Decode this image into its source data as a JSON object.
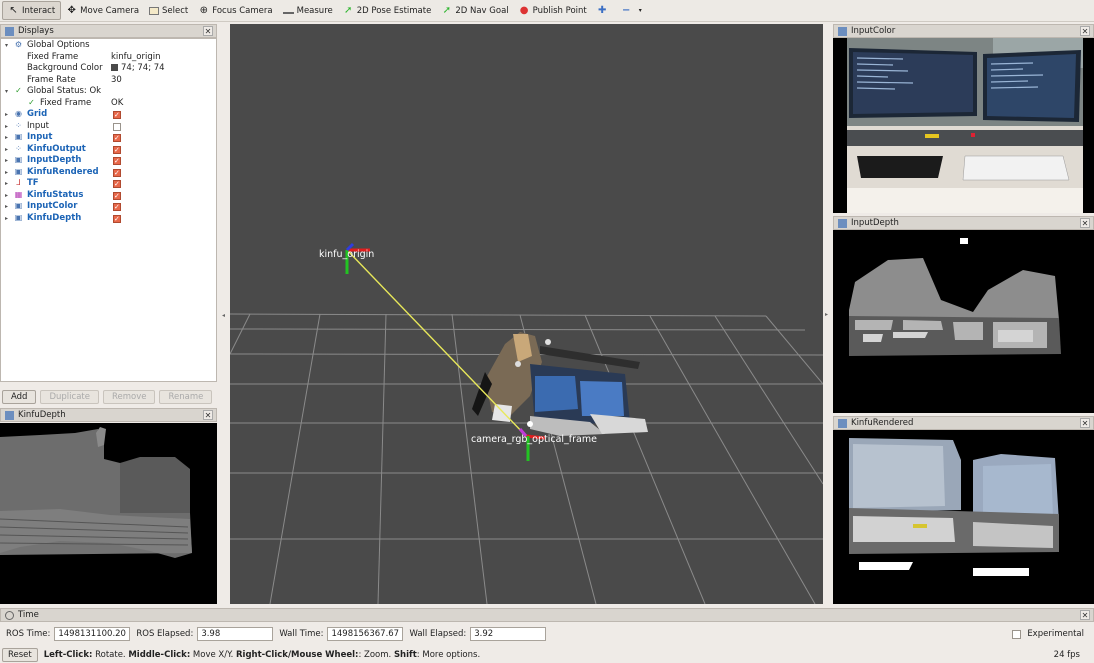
{
  "toolbar": {
    "tools": [
      {
        "label": "Interact",
        "icon": "interact-icon",
        "active": true
      },
      {
        "label": "Move Camera",
        "icon": "move-camera-icon"
      },
      {
        "label": "Select",
        "icon": "select-icon"
      },
      {
        "label": "Focus Camera",
        "icon": "focus-camera-icon"
      },
      {
        "label": "Measure",
        "icon": "measure-icon"
      },
      {
        "label": "2D Pose Estimate",
        "icon": "pose-estimate-icon"
      },
      {
        "label": "2D Nav Goal",
        "icon": "nav-goal-icon"
      },
      {
        "label": "Publish Point",
        "icon": "publish-point-icon"
      }
    ]
  },
  "displays": {
    "title": "Displays",
    "global_options": {
      "label": "Global Options",
      "fixed_frame_label": "Fixed Frame",
      "fixed_frame_value": "kinfu_origin",
      "background_color_label": "Background Color",
      "background_color_value": "74; 74; 74",
      "frame_rate_label": "Frame Rate",
      "frame_rate_value": "30"
    },
    "global_status": {
      "label": "Global Status: Ok",
      "fixed_frame_label": "Fixed Frame",
      "fixed_frame_value": "OK"
    },
    "items": [
      {
        "label": "Grid",
        "checked": true,
        "bold": true
      },
      {
        "label": "Input",
        "checked": false,
        "bold": false
      },
      {
        "label": "Input",
        "checked": true,
        "bold": true
      },
      {
        "label": "KinfuOutput",
        "checked": true,
        "bold": true
      },
      {
        "label": "InputDepth",
        "checked": true,
        "bold": true
      },
      {
        "label": "KinfuRendered",
        "checked": true,
        "bold": true
      },
      {
        "label": "TF",
        "checked": true,
        "bold": true
      },
      {
        "label": "KinfuStatus",
        "checked": true,
        "bold": true
      },
      {
        "label": "InputColor",
        "checked": true,
        "bold": true
      },
      {
        "label": "KinfuDepth",
        "checked": true,
        "bold": true
      }
    ],
    "buttons": {
      "add": "Add",
      "duplicate": "Duplicate",
      "remove": "Remove",
      "rename": "Rename"
    }
  },
  "panels": {
    "kinfu_depth": "KinfuDepth",
    "input_color": "InputColor",
    "input_depth": "InputDepth",
    "kinfu_rendered": "KinfuRendered"
  },
  "view3d": {
    "frame_labels": {
      "origin": "kinfu_origin",
      "camera": "camera_rgb_optical_frame"
    }
  },
  "time": {
    "title": "Time",
    "ros_time_label": "ROS Time:",
    "ros_time_value": "1498131100.20",
    "ros_elapsed_label": "ROS Elapsed:",
    "ros_elapsed_value": "3.98",
    "wall_time_label": "Wall Time:",
    "wall_time_value": "1498156367.67",
    "wall_elapsed_label": "Wall Elapsed:",
    "wall_elapsed_value": "3.92",
    "experimental_label": "Experimental"
  },
  "status": {
    "reset": "Reset",
    "left_click": "Left-Click:",
    "left_click_text": " Rotate. ",
    "middle_click": "Middle-Click:",
    "middle_click_text": " Move X/Y. ",
    "right_click": "Right-Click/Mouse Wheel:",
    "right_click_text": ": Zoom. ",
    "shift": "Shift",
    "shift_text": ": More options.",
    "fps": "24 fps"
  },
  "colors": {
    "background": "#4a4a4a",
    "accent": "#1c64b6",
    "check": "#e8684a"
  }
}
